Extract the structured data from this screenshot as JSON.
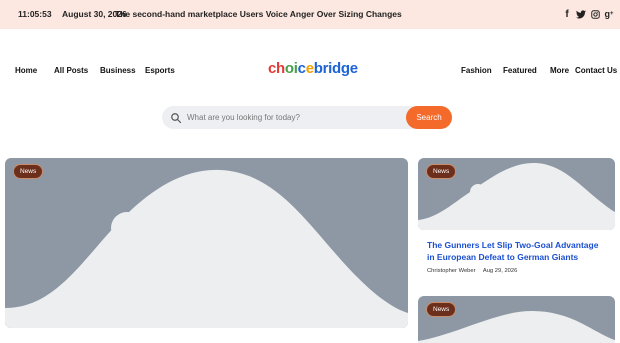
{
  "topbar": {
    "time": "11:05:53",
    "date": "August 30, 2026",
    "ticker": "The second-hand marketplace Users Voice Anger Over Sizing Changes",
    "social_icons": [
      "facebook-icon",
      "twitter-icon",
      "instagram-icon",
      "google-plus-icon"
    ]
  },
  "nav": {
    "left": [
      "Home",
      "All Posts",
      "Business",
      "Esports"
    ],
    "right": [
      "Fashion",
      "Featured",
      "More",
      "Contact Us"
    ]
  },
  "logo": {
    "part1": "choice",
    "part2": "bridge"
  },
  "search": {
    "placeholder": "What are you looking for today?",
    "button_label": "Search"
  },
  "cards": {
    "main": {
      "badge": "News"
    },
    "side1": {
      "badge": "News",
      "headline": "The Gunners Let Slip Two-Goal Advantage in European Defeat to German Giants",
      "author": "Christopher Weber",
      "date": "Aug 29, 2026"
    },
    "side2": {
      "badge": "News"
    }
  },
  "colors": {
    "topbar_bg": "#fce8e1",
    "accent": "#f36a2b",
    "headline": "#1a4fd1",
    "placeholder_img": "#8d98a4"
  }
}
